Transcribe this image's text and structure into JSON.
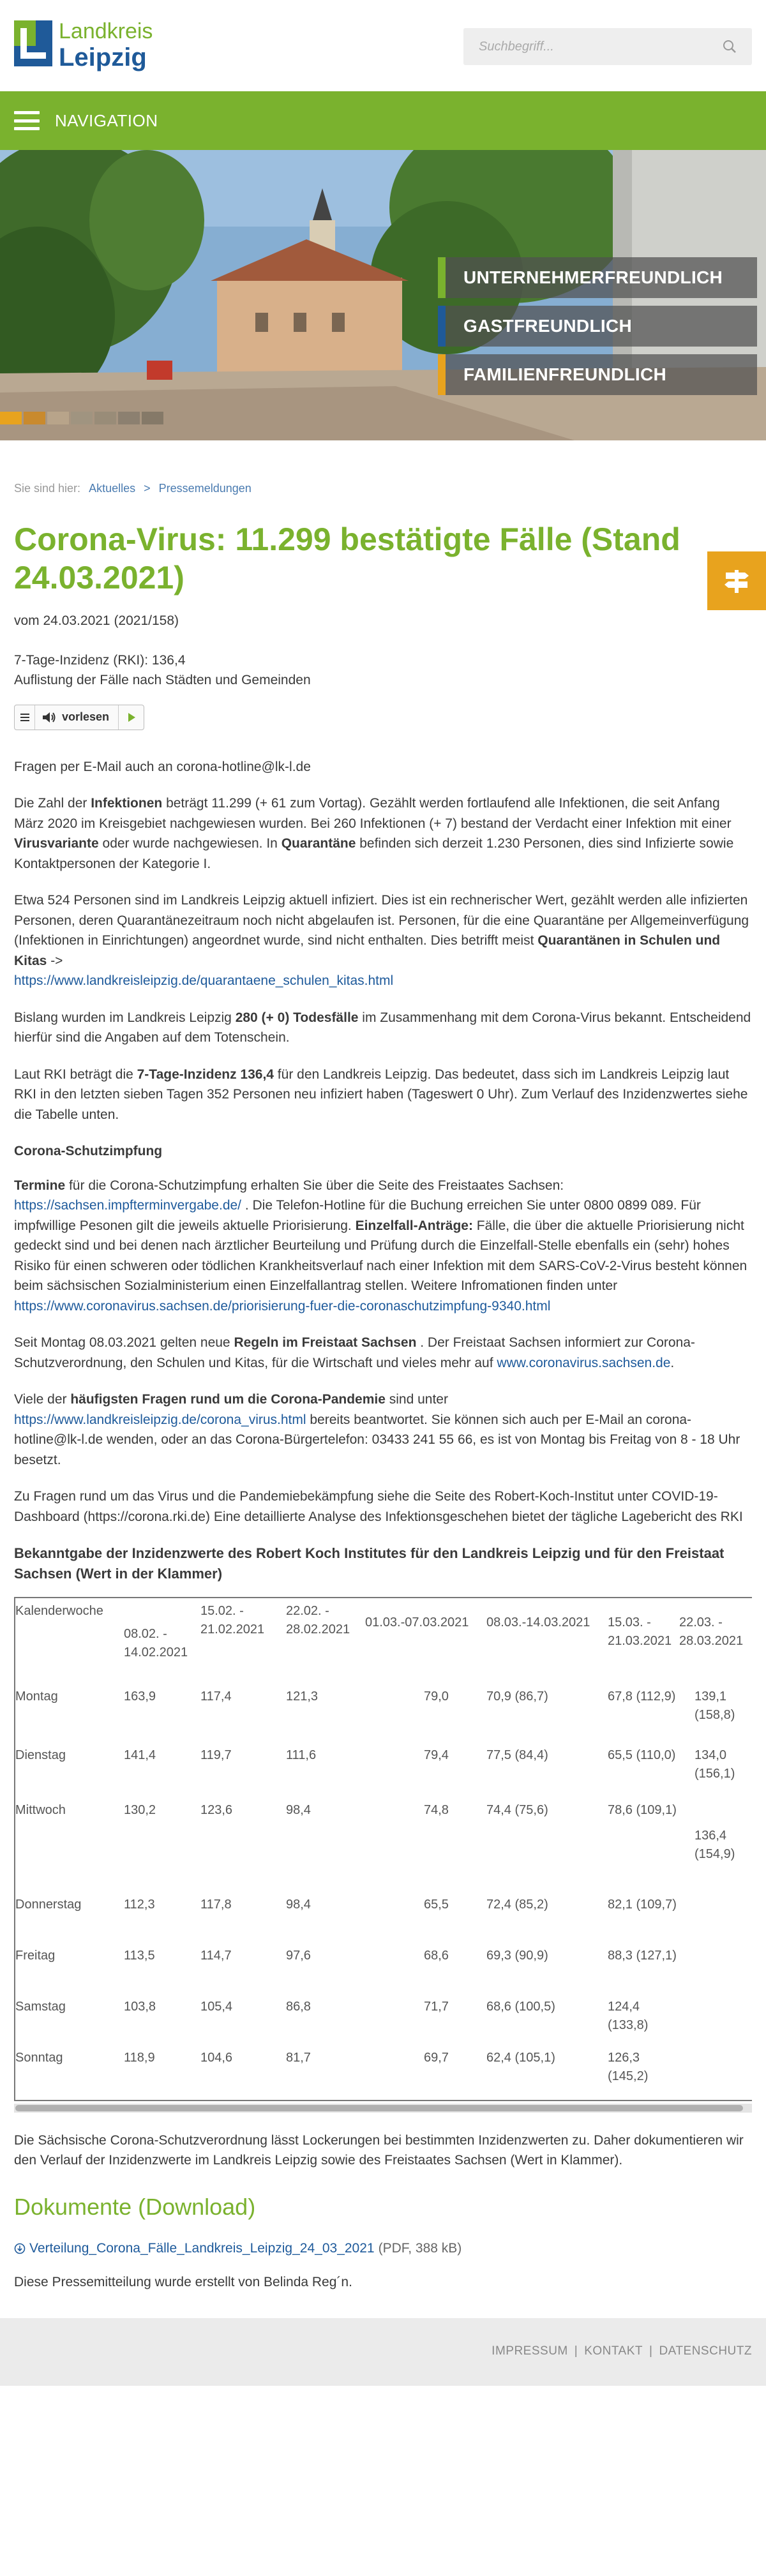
{
  "logo": {
    "line1": "Landkreis",
    "line2": "Leipzig"
  },
  "search": {
    "placeholder": "Suchbegriff..."
  },
  "nav": {
    "label": "NAVIGATION"
  },
  "hero": {
    "badges": [
      {
        "text": "UNTERNEHMERFREUNDLICH",
        "color": "#7ab22e"
      },
      {
        "text": "GASTFREUNDLICH",
        "color": "#1f5a99"
      },
      {
        "text": "FAMILIENFREUNDLICH",
        "color": "#e8a31e"
      }
    ]
  },
  "breadcrumb": {
    "prefix": "Sie sind hier:",
    "items": [
      "Aktuelles",
      "Pressemeldungen"
    ],
    "separator": ">"
  },
  "article": {
    "title": "Corona-Virus: 11.299 bestätigte Fälle (Stand 24.03.2021)",
    "date": "vom 24.03.2021 (2021/158)",
    "intro1": "7-Tage-Inzidenz (RKI): 136,4",
    "intro2": "Auflistung der Fälle nach Städten und Gemeinden",
    "readspeaker_label": "vorlesen",
    "p_email": "Fragen per E-Mail auch an corona-hotline@lk-l.de",
    "p1": {
      "a": "Die Zahl der ",
      "b": "Infektionen",
      "c": " beträgt 11.299 (+ 61 zum Vortag). Gezählt werden fortlaufend alle Infektionen, die seit Anfang März 2020 im Kreisgebiet nachgewiesen wurden. Bei 260 Infektionen (+ 7) bestand der Verdacht einer Infektion mit einer ",
      "d": "Virusvariante",
      "e": " oder wurde nachgewiesen. In ",
      "f": "Quarantäne",
      "g": " befinden sich derzeit 1.230 Personen, dies sind Infizierte sowie Kontaktpersonen der Kategorie I."
    },
    "p2": {
      "a": "Etwa 524 Personen sind im Landkreis Leipzig aktuell infiziert. Dies ist ein rechnerischer Wert, gezählt werden alle infizierten Personen, deren Quarantänezeitraum noch nicht abgelaufen ist. Personen, für die eine Quarantäne per Allgemeinverfügung (Infektionen in Einrichtungen) angeordnet wurde, sind nicht enthalten. Dies betrifft meist  ",
      "b": "Quarantänen in Schulen und Kitas",
      "c": " -> ",
      "link": "https://www.landkreisleipzig.de/quarantaene_schulen_kitas.html"
    },
    "p3": {
      "a": "Bislang wurden im Landkreis Leipzig ",
      "b": "280 (+ 0) Todesfälle",
      "c": " im Zusammenhang mit dem Corona-Virus bekannt. Entscheidend hierfür sind die Angaben auf dem Totenschein."
    },
    "p4": {
      "a": "Laut RKI beträgt die ",
      "b": "7-Tage-Inzidenz 136,4",
      "c": " für den Landkreis Leipzig. Das bedeutet, dass sich im Landkreis Leipzig laut RKI in den letzten sieben Tagen 352 Personen neu infiziert haben (Tageswert 0 Uhr). Zum Verlauf des Inzidenzwertes siehe die Tabelle unten."
    },
    "h_impf": "Corona-Schutzimpfung",
    "p5": {
      "a": "Termine",
      "b": " für die Corona-Schutzimpfung erhalten Sie über die Seite des Freistaates Sachsen: ",
      "link1": "https://sachsen.impfterminvergabe.de/",
      "c": " . Die Telefon-Hotline für die Buchung erreichen Sie unter 0800 0899 089. Für impfwillige Pesonen gilt die jeweils aktuelle Priorisierung. ",
      "d": "Einzelfall-Anträge:",
      "e": " Fälle, die über die aktuelle Priorisierung nicht gedeckt sind und bei denen nach ärztlicher Beurteilung und Prüfung durch die Einzelfall-Stelle ebenfalls ein (sehr) hohes Risiko für einen schweren oder tödlichen Krankheitsverlauf nach einer Infektion mit dem SARS-CoV-2-Virus besteht können beim sächsischen Sozialministerium einen Einzelfallantrag stellen. Weitere Infromationen finden unter ",
      "link2": "https://www.coronavirus.sachsen.de/priorisierung-fuer-die-coronaschutzimpfung-9340.html"
    },
    "p6": {
      "a": "Seit Montag 08.03.2021 gelten neue ",
      "b": "Regeln im Freistaat Sachsen",
      "c": " . Der Freistaat Sachsen informiert zur Corona-Schutzverordnung, den Schulen und Kitas, für die Wirtschaft und vieles mehr auf ",
      "link": "www.coronavirus.sachsen.de",
      "d": "."
    },
    "p7": {
      "a": "Viele der ",
      "b": "häufigsten Fragen rund um die Corona-Pandemie",
      "c": " sind unter ",
      "link": "https://www.landkreisleipzig.de/corona_virus.html",
      "d": " bereits beantwortet. Sie können sich auch per E-Mail an corona-hotline@lk-l.de wenden, oder an das Corona-Bürgertelefon: 03433 241 55 66, es ist von Montag bis Freitag von 8 - 18 Uhr besetzt."
    },
    "p8": "Zu Fragen rund um das Virus und die Pandemiebekämpfung siehe die Seite des Robert-Koch-Institut unter COVID-19-Dashboard (https://corona.rki.de)  Eine detaillierte Analyse des Infektionsgeschehen bietet der tägliche Lagebericht des RKI",
    "h_table": "Bekanntgabe der Inzidenzwerte des Robert Koch Institutes für den Landkreis Leipzig und für den Freistaat Sachsen (Wert in der Klammer)",
    "table": {
      "header": [
        "Kalenderwoche",
        "08.02. - 14.02.2021",
        "15.02. - 21.02.2021",
        "22.02. - 28.02.2021",
        "01.03.-07.03.2021",
        "08.03.-14.03.2021",
        "15.03. - 21.03.2021",
        "22.03. - 28.03.2021"
      ],
      "rows": [
        [
          "Montag",
          "163,9",
          "117,4",
          "121,3",
          "79,0",
          "70,9 (86,7)",
          "67,8 (112,9)",
          "139,1 (158,8)"
        ],
        [
          "Dienstag",
          "141,4",
          "119,7",
          "111,6",
          "79,4",
          "77,5 (84,4)",
          "65,5 (110,0)",
          "134,0 (156,1)"
        ],
        [
          "Mittwoch",
          "130,2",
          "123,6",
          "98,4",
          "74,8",
          "74,4 (75,6)",
          "78,6 (109,1)",
          "136,4 (154,9)"
        ],
        [
          "Donnerstag",
          "112,3",
          "117,8",
          "98,4",
          "65,5",
          "72,4 (85,2)",
          "82,1 (109,7)",
          ""
        ],
        [
          "Freitag",
          "113,5",
          "114,7",
          "97,6",
          "68,6",
          "69,3 (90,9)",
          "88,3 (127,1)",
          ""
        ],
        [
          "Samstag",
          "103,8",
          "105,4",
          "86,8",
          "71,7",
          "68,6 (100,5)",
          "124,4 (133,8)",
          ""
        ],
        [
          "Sonntag",
          "118,9",
          "104,6",
          "81,7",
          "69,7",
          "62,4 (105,1)",
          "126,3 (145,2)",
          ""
        ]
      ]
    },
    "p9": "Die Sächsische Corona-Schutzverordnung lässt Lockerungen bei bestimmten Inzidenzwerten zu. Daher dokumentieren wir den Verlauf der Inzidenzwerte im Landkreis Leipzig sowie des Freistaates Sachsen (Wert in Klammer).",
    "h_docs": "Dokumente (Download)",
    "doc": {
      "name": "Verteilung_Corona_Fälle_Landkreis_Leipzig_24_03_2021",
      "meta": "(PDF, 388 kB)"
    },
    "author": "Diese Pressemitteilung wurde erstellt von Belinda Reg´n."
  },
  "footer": {
    "links": [
      "IMPRESSUM",
      "KONTAKT",
      "DATENSCHUTZ"
    ],
    "separator": "|"
  }
}
